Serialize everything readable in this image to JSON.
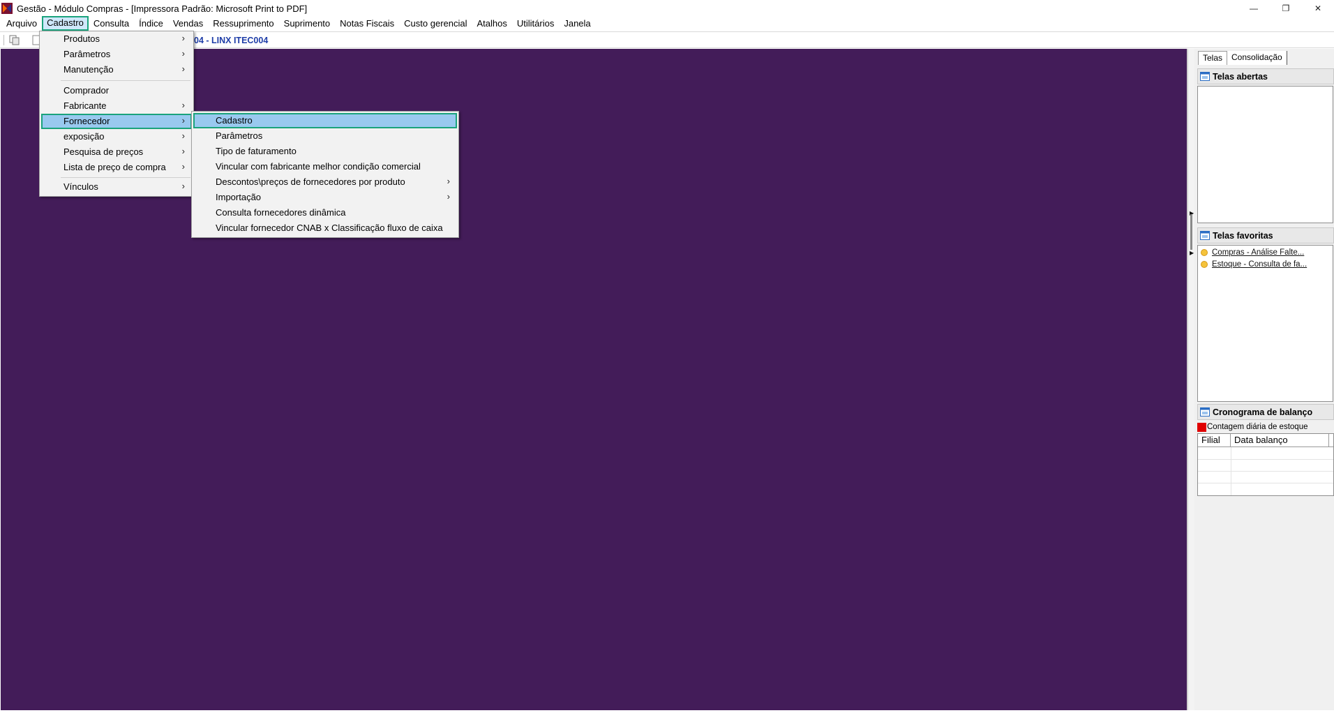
{
  "window": {
    "title": "Gestão  - Módulo Compras - [Impressora Padrão: Microsoft Print to PDF]",
    "controls": {
      "minimize": "—",
      "restore": "❐",
      "close": "✕"
    }
  },
  "menubar": {
    "items": [
      "Arquivo",
      "Cadastro",
      "Consulta",
      "Índice",
      "Vendas",
      "Ressuprimento",
      "Suprimento",
      "Notas Fiscais",
      "Custo gerencial",
      "Atalhos",
      "Utilitários",
      "Janela"
    ],
    "active_index": 1
  },
  "toolbar": {
    "identity": "04 - LINX ITEC004"
  },
  "cadastro_menu": {
    "items": [
      {
        "label": "Produtos",
        "submenu": true
      },
      {
        "label": "Parâmetros",
        "submenu": true
      },
      {
        "label": "Manutenção",
        "submenu": true
      },
      {
        "label": "Comprador",
        "submenu": false
      },
      {
        "label": "Fabricante",
        "submenu": true
      },
      {
        "label": "Fornecedor",
        "submenu": true,
        "highlighted": true
      },
      {
        "label": "exposição",
        "submenu": true
      },
      {
        "label": "Pesquisa de preços",
        "submenu": true
      },
      {
        "label": "Lista de preço de compra",
        "submenu": true
      },
      {
        "label": "Vínculos",
        "submenu": true
      }
    ]
  },
  "fornecedor_menu": {
    "items": [
      {
        "label": "Cadastro",
        "submenu": false,
        "highlighted": true
      },
      {
        "label": "Parâmetros",
        "submenu": false
      },
      {
        "label": "Tipo de faturamento",
        "submenu": false
      },
      {
        "label": "Vincular com fabricante melhor condição comercial",
        "submenu": false
      },
      {
        "label": "Descontos\\preços de fornecedores por produto",
        "submenu": true
      },
      {
        "label": "Importação",
        "submenu": true
      },
      {
        "label": "Consulta fornecedores dinâmica",
        "submenu": false
      },
      {
        "label": "Vincular fornecedor CNAB x Classificação fluxo de caixa",
        "submenu": false
      }
    ]
  },
  "right_panel": {
    "tabs": [
      "Telas",
      "Consolidação"
    ],
    "telas_abertas": {
      "title": "Telas abertas"
    },
    "telas_favoritas": {
      "title": "Telas favoritas",
      "items": [
        "Compras -  Análise Falte...",
        "Estoque - Consulta de fa..."
      ]
    },
    "cronograma": {
      "title": "Cronograma de balanço",
      "legend": "Contagem diária de estoque",
      "columns": [
        "Filial",
        "Data balanço"
      ]
    }
  },
  "colors": {
    "workspace": "#431c59",
    "highlight_border": "#1aa37c",
    "highlight_fill": "#99c9ef",
    "identity_text": "#1f3ea8",
    "legend_red": "#e00000"
  }
}
